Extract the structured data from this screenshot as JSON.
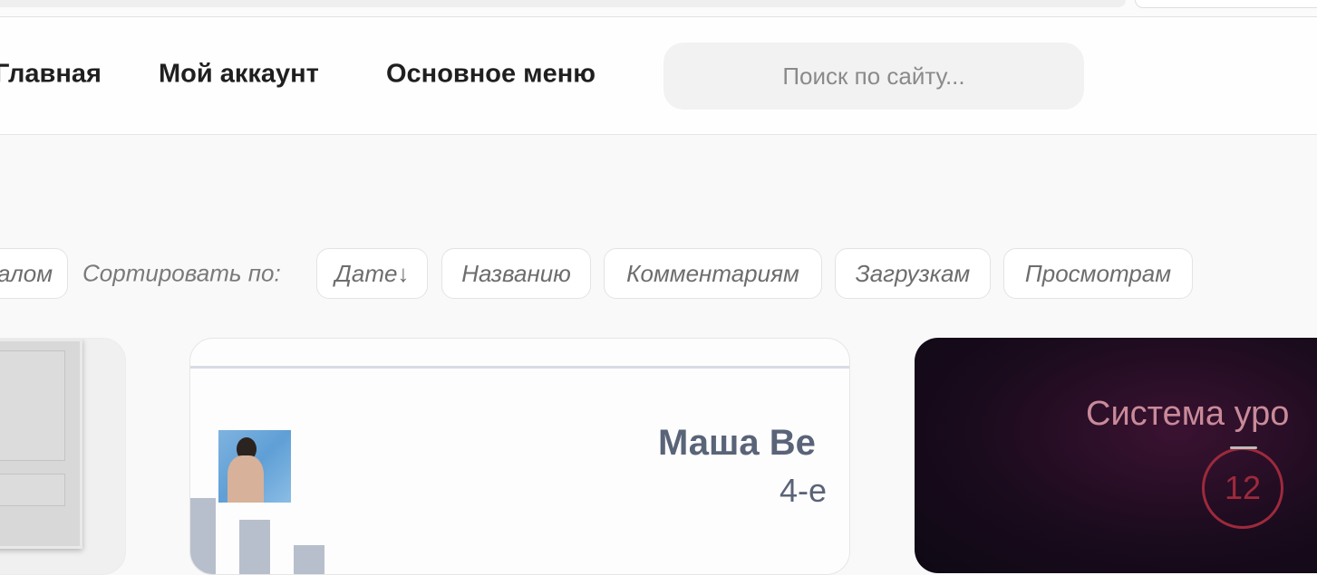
{
  "nav": {
    "items": [
      "Главная",
      "Мой аккаунт",
      "Основное меню"
    ],
    "search_placeholder": "Поиск по сайту..."
  },
  "sort": {
    "prev_chip": "алом",
    "label": "Сортировать по:",
    "options": [
      "Дате↓",
      "Названию",
      "Комментариям",
      "Загрузкам",
      "Просмотрам"
    ]
  },
  "cards": {
    "middle": {
      "name": "Маша Ве",
      "subtitle": "4-е"
    },
    "right": {
      "title": "Система уро",
      "level": "12"
    }
  }
}
